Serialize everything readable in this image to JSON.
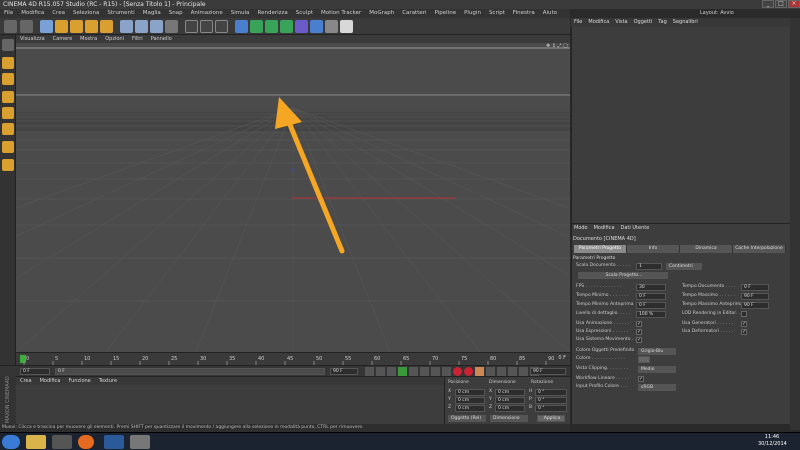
{
  "window": {
    "title": "CINEMA 4D R15.057 Studio (RC - R15) - [Senza Titolo 1] - Principale",
    "controls": [
      "_",
      "□",
      "×"
    ]
  },
  "menubar": {
    "items": [
      "File",
      "Modifica",
      "Crea",
      "Seleziona",
      "Strumenti",
      "Maglia",
      "Snap",
      "Animazione",
      "Simula",
      "Renderizza",
      "Sculpt",
      "Motion Tracker",
      "MoGraph",
      "Caratteri",
      "Pipeline",
      "Plugin",
      "Script",
      "Finestra",
      "Aiuto"
    ],
    "layout_label": "Layout: Avvio"
  },
  "viewport": {
    "menu": [
      "Visualizza",
      "Camere",
      "Mostra",
      "Opzioni",
      "Filtri",
      "Pannello"
    ],
    "view_label": "Prospettiva"
  },
  "timeline": {
    "ticks": [
      "0",
      "5",
      "10",
      "15",
      "20",
      "25",
      "30",
      "35",
      "40",
      "45",
      "50",
      "55",
      "60",
      "65",
      "70",
      "75",
      "80",
      "85",
      "90"
    ],
    "end_label": "0 F",
    "start_field": "0 F",
    "current_field": "0 F",
    "end_field": "90 F",
    "end_field2": "90 F"
  },
  "material_panel": {
    "menu": [
      "Crea",
      "Modifica",
      "Funzione",
      "Texture"
    ]
  },
  "coord_panel": {
    "headers": [
      "Posizione",
      "Dimensione",
      "Rotazione"
    ],
    "rows": [
      {
        "axis": "X",
        "pos": "0 cm",
        "axis2": "X",
        "size": "0 cm",
        "axis3": "H",
        "rot": "0 °"
      },
      {
        "axis": "Y",
        "pos": "0 cm",
        "axis2": "Y",
        "size": "0 cm",
        "axis3": "P",
        "rot": "0 °"
      },
      {
        "axis": "Z",
        "pos": "0 cm",
        "axis2": "Z",
        "size": "0 cm",
        "axis3": "B",
        "rot": "0 °"
      }
    ],
    "mode_select": "Oggetto (Rel)",
    "size_select": "Dimensione",
    "apply_button": "Applica"
  },
  "logo_text": "MAXON CINEMA4D",
  "statusbar": "Muovi: Clicca e trascina per muovere gli elementi. Premi SHIFT per quantizzare il movimento / aggiungere alla selezione in modalità punto, CTRL per rimuovere.",
  "object_panel": {
    "menu": [
      "File",
      "Modifica",
      "Vista",
      "Oggetti",
      "Tag",
      "Segnalibri"
    ]
  },
  "attr_panel": {
    "menu": [
      "Modo",
      "Modifica",
      "Dati Utente"
    ],
    "title": "Documento [CINEMA 4D]",
    "tabs": [
      "Parametri Progetto",
      "Info",
      "Dinamica",
      "Cache Interpolazione"
    ],
    "section": "Parametri Progetto",
    "scale_label": "Scala Documento . . . . .",
    "scale_value": "1",
    "scale_unit": "Centimetri",
    "scale_button": "Scala Progetto...",
    "rows_left": [
      {
        "label": "FPS . . . . . . . . . . . . .",
        "value": "30"
      },
      {
        "label": "Tempo Minimo . . . . . . .",
        "value": "0 F"
      },
      {
        "label": "Tempo Minimo Anteprima",
        "value": "0 F"
      }
    ],
    "rows_right": [
      {
        "label": "Tempo Documento . . . .",
        "value": "0 F"
      },
      {
        "label": "Tempo Massimo . . . . . .",
        "value": "90 F"
      },
      {
        "label": "Tempo Massimo Anteprima",
        "value": "90 F"
      }
    ],
    "lod_label": "Livello di dettaglio. . . . .",
    "lod_value": "100 %",
    "lod_render_label": "LOD Rendering in Editor. .",
    "check_left": [
      {
        "label": "Usa Animazione . . . . . .",
        "checked": "✓"
      },
      {
        "label": "Usa Espressioni . . . . . .",
        "checked": "✓"
      },
      {
        "label": "Usa Sistema Movimento . .",
        "checked": "✓"
      }
    ],
    "check_right": [
      {
        "label": "Usa Generatori . . . . . .",
        "checked": "✓"
      },
      {
        "label": "Usa Deformatori . . . . .",
        "checked": "✓"
      }
    ],
    "color_label": "Colore Oggetti Predefinito",
    "color_value": "Grigio-Blu",
    "color2_label": "Colore . . . . . . . . . . . .",
    "clipping_label": "Vista Clipping. . . . . . . .",
    "clipping_value": "Medio",
    "linear_label": "Workflow Lineare . . . . .",
    "linear_checked": "✓",
    "profile_label": "Input Profilo Colore . . .",
    "profile_value": "sRGB"
  },
  "taskbar": {
    "time": "11:46",
    "date": "30/12/2014"
  }
}
